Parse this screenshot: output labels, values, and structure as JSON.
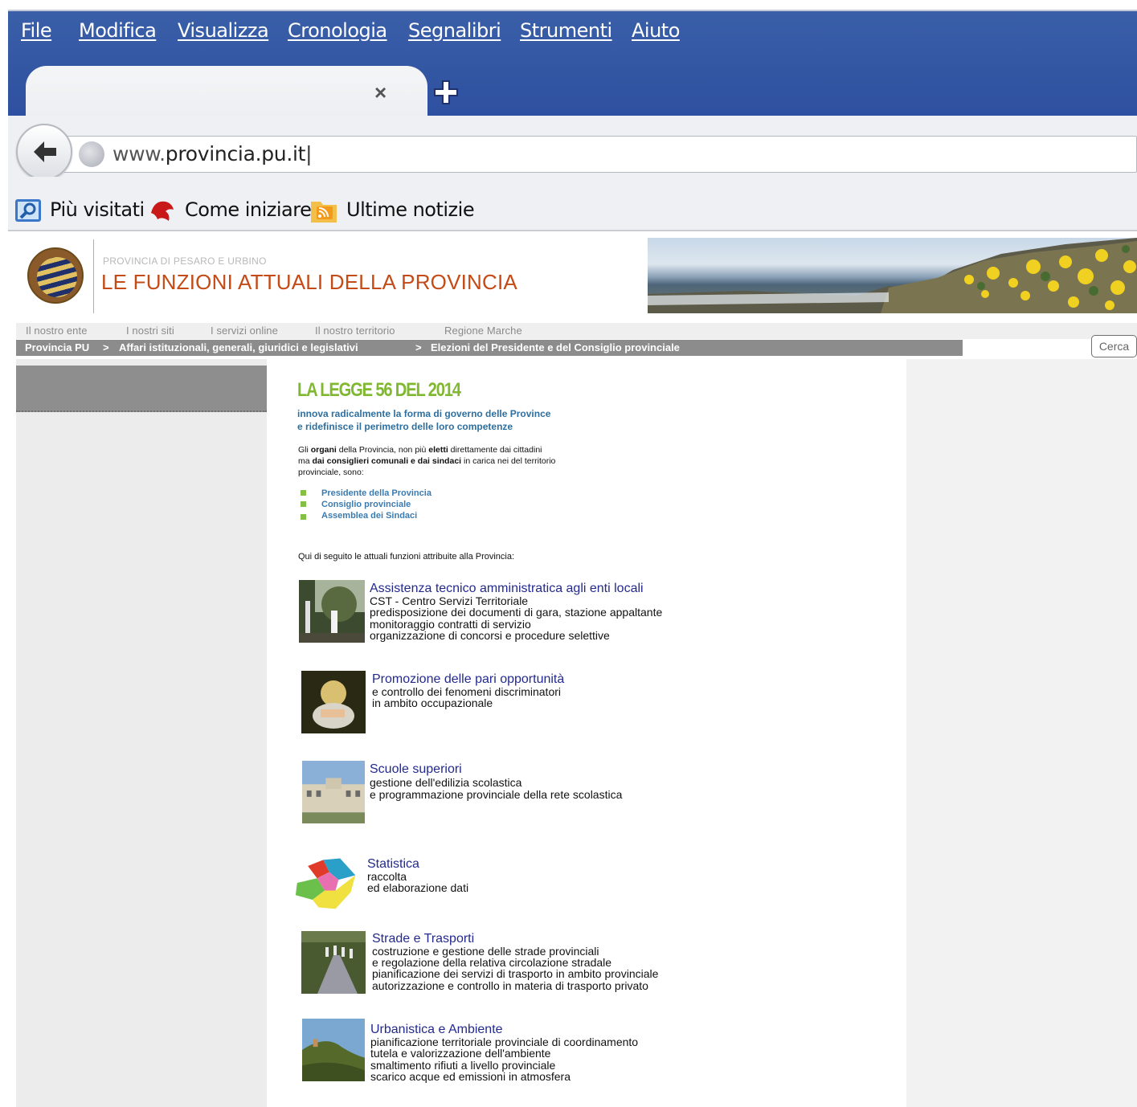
{
  "browser": {
    "menu": [
      "File",
      "Modifica",
      "Visualizza",
      "Cronologia",
      "Segnalibri",
      "Strumenti",
      "Aiuto"
    ],
    "tab_close": "×",
    "url_prefix": "www.",
    "url_domain": "provincia.pu.it",
    "bookmarks": [
      "Più visitati",
      "Come iniziare",
      "Ultime notizie"
    ],
    "icons": [
      "back-arrow-icon",
      "globe-icon",
      "magnifier-icon",
      "dragon-icon",
      "rss-icon",
      "plus-icon",
      "close-icon"
    ]
  },
  "site": {
    "pre_title": "PROVINCIA DI PESARO E URBINO",
    "title": "LE FUNZIONI ATTUALI DELLA PROVINCIA",
    "nav": [
      "Il nostro ente",
      "I nostri siti",
      "I servizi online",
      "Il nostro territorio",
      "Regione Marche"
    ],
    "breadcrumb": [
      "Provincia PU",
      ">",
      "Affari istituzionali, generali, giuridici e legislativi",
      ">",
      "Elezioni del Presidente e del Consiglio provinciale"
    ],
    "search_button": "Cerca"
  },
  "article": {
    "law_title": "LA LEGGE 56 DEL 2014",
    "law_sub": [
      "innova radicalmente la forma di governo delle Province",
      "e ridefinisce il perimetro delle loro competenze"
    ],
    "organs_intro": {
      "l1_a": "Gli ",
      "l1_b": "organi",
      "l1_c": " della Provincia, non più ",
      "l1_d": "eletti",
      "l1_e": " direttamente dai cittadini",
      "l2_a": "ma ",
      "l2_b": "dai consiglieri comunali e dai sindaci",
      "l2_c": " in carica nei del territorio",
      "l3": "provinciale, sono:"
    },
    "organs": [
      "Presidente della Provincia",
      "Consiglio provinciale",
      "Assemblea dei Sindaci"
    ],
    "functions_intro": "Qui di seguito le attuali funzioni attribuite alla Provincia:",
    "functions": [
      {
        "title": "Assistenza tecnico amministratica agli enti locali",
        "lines": [
          "CST - Centro Servizi Territoriale",
          "predisposizione dei documenti di gara, stazione appaltante",
          "monitoraggio contratti di servizio",
          "organizzazione di concorsi e procedure selettive"
        ]
      },
      {
        "title": "Promozione delle pari opportunità",
        "lines": [
          "e controllo dei fenomeni discriminatori",
          "in ambito occupazionale"
        ]
      },
      {
        "title": "Scuole superiori",
        "lines": [
          "gestione dell'edilizia scolastica",
          "e programmazione provinciale della rete scolastica"
        ]
      },
      {
        "title": "Statistica",
        "lines": [
          "raccolta",
          "ed elaborazione dati"
        ]
      },
      {
        "title": "Strade e Trasporti",
        "lines": [
          "costruzione  e gestione delle strade provinciali",
          "e regolazione della relativa circolazione stradale",
          "pianificazione dei servizi di trasporto in ambito provinciale",
          "autorizzazione e controllo in materia di trasporto privato"
        ]
      },
      {
        "title": "Urbanistica e Ambiente",
        "lines": [
          "pianificazione  territoriale  provinciale di coordinamento",
          "tutela e valorizzazione dell'ambiente",
          "smaltimento rifiuti a livello provinciale",
          "scarico acque ed emissioni in atmosfera"
        ]
      }
    ]
  }
}
